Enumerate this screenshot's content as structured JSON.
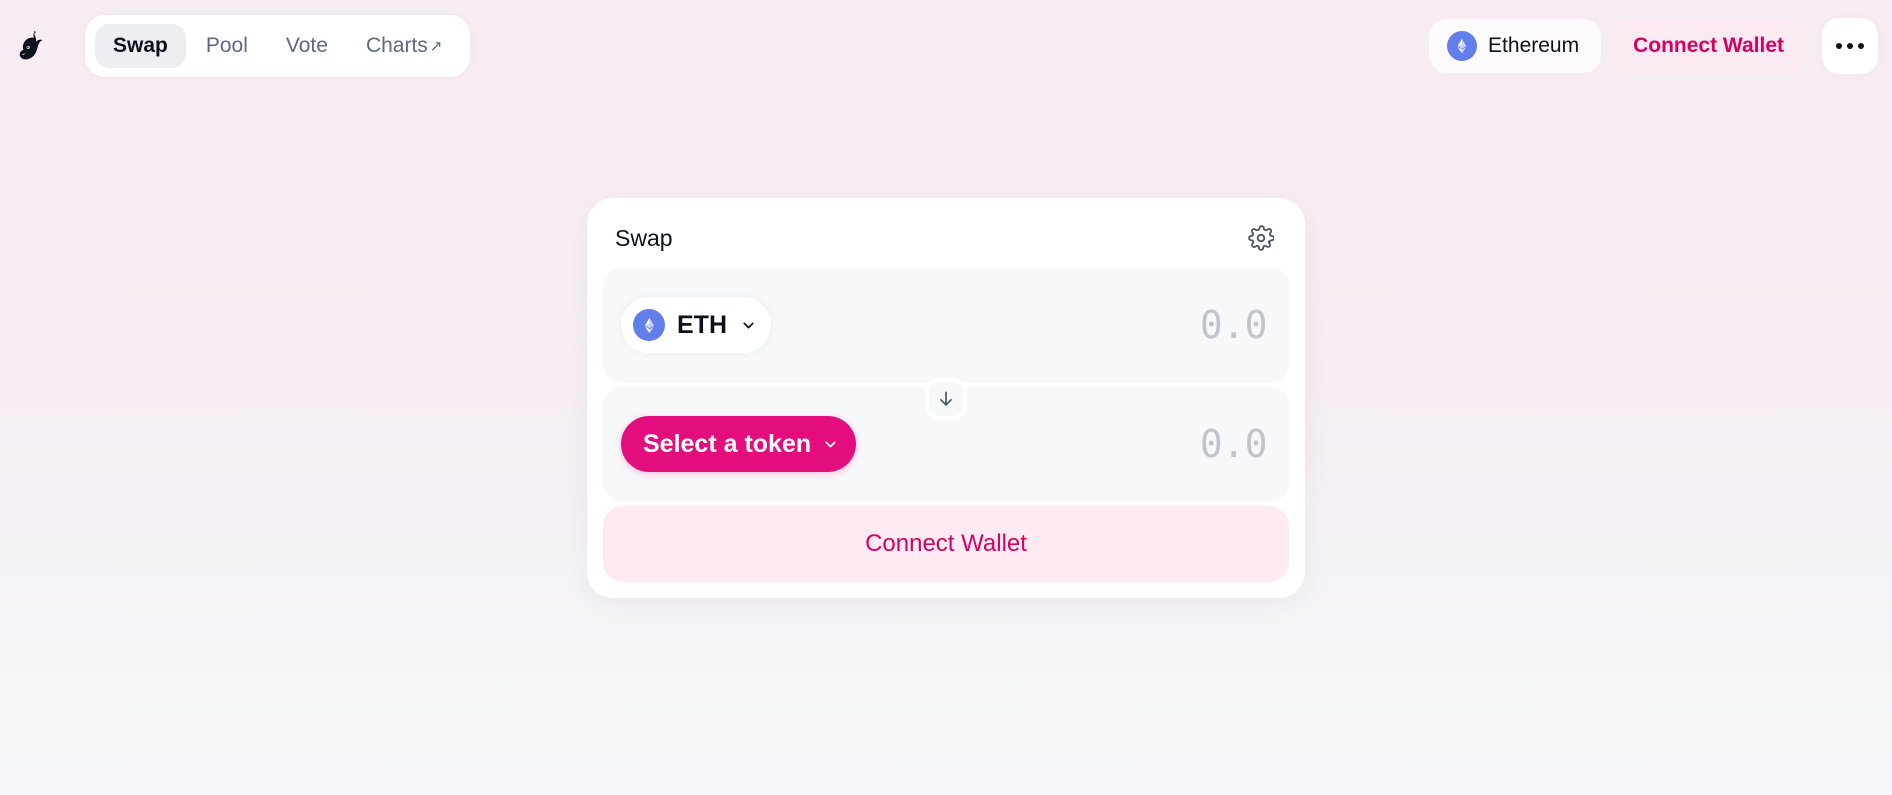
{
  "header": {
    "logo_icon": "uniswap-unicorn-logo",
    "nav": [
      {
        "label": "Swap",
        "active": true,
        "external": false
      },
      {
        "label": "Pool",
        "active": false,
        "external": false
      },
      {
        "label": "Vote",
        "active": false,
        "external": false
      },
      {
        "label": "Charts",
        "active": false,
        "external": true,
        "external_glyph": "↗"
      }
    ],
    "chain": {
      "name": "Ethereum",
      "icon": "ethereum-icon",
      "icon_color": "#627EEA"
    },
    "connect_wallet_label": "Connect Wallet",
    "more_menu_icon": "more-horizontal-icon"
  },
  "swap_card": {
    "title": "Swap",
    "settings_icon": "gear-icon",
    "swap_direction_icon": "arrow-down-icon",
    "input_field": {
      "token_symbol": "ETH",
      "token_icon": "ethereum-icon",
      "chevron_icon": "chevron-down-icon",
      "amount_value": "",
      "amount_placeholder": "0.0"
    },
    "output_field": {
      "select_token_label": "Select a token",
      "chevron_icon": "chevron-down-icon",
      "amount_value": "",
      "amount_placeholder": "0.0"
    },
    "cta_label": "Connect Wallet"
  },
  "colors": {
    "brand_pink": "#E40D7E",
    "cta_text": "#D6015F",
    "cta_bg": "#FDEAF2",
    "ethereum_blue": "#627EEA",
    "background_top": "#F8ECF4",
    "background_bottom": "#F6F7FA",
    "field_bg": "#F7F8FA",
    "text_primary": "#0D111C",
    "text_secondary": "#5D6785",
    "placeholder": "#BFC4CE"
  }
}
